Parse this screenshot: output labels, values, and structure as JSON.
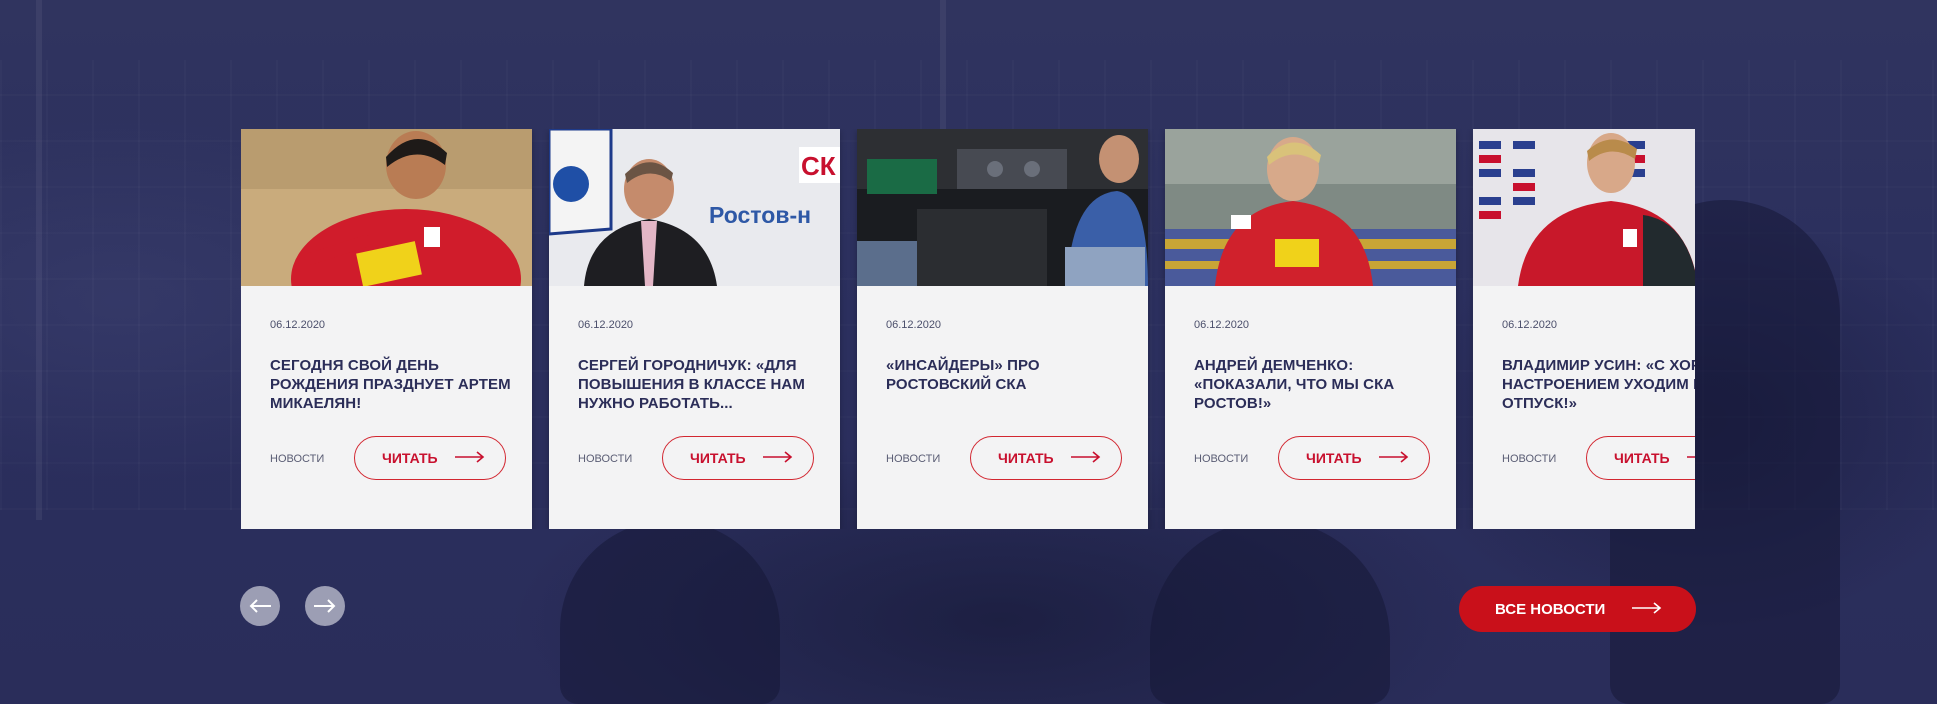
{
  "news": {
    "cards": [
      {
        "date": "06.12.2020",
        "title": "СЕГОДНЯ СВОЙ ДЕНЬ РОЖДЕНИЯ ПРАЗДНУЕТ АРТЕМ МИКАЕЛЯН!",
        "category": "НОВОСТИ",
        "read_label": "ЧИТАТЬ"
      },
      {
        "date": "06.12.2020",
        "title": "СЕРГЕЙ ГОРОДНИЧУК: «ДЛЯ ПОВЫШЕНИЯ  В КЛАССЕ НАМ НУЖНО РАБОТАТЬ...",
        "category": "НОВОСТИ",
        "read_label": "ЧИТАТЬ",
        "image_text": "Ростов-н"
      },
      {
        "date": "06.12.2020",
        "title": "«ИНСАЙДЕРЫ» ПРО РОСТОВСКИЙ СКА",
        "category": "НОВОСТИ",
        "read_label": "ЧИТАТЬ"
      },
      {
        "date": "06.12.2020",
        "title": "АНДРЕЙ ДЕМЧЕНКО: «ПОКАЗАЛИ, ЧТО МЫ СКА РОСТОВ!»",
        "category": "НОВОСТИ",
        "read_label": "ЧИТАТЬ"
      },
      {
        "date": "06.12.2020",
        "title": "ВЛАДИМИР УСИН: «С ХОРОШИМ НАСТРОЕНИЕМ УХОДИМ В ОТПУСК!»",
        "category": "НОВОСТИ",
        "read_label": "ЧИТАТЬ"
      }
    ]
  },
  "controls": {
    "prev_icon": "arrow-left-icon",
    "next_icon": "arrow-right-icon",
    "all_news_label": "ВСЕ НОВОСТИ"
  },
  "colors": {
    "background": "#2a2e5e",
    "card": "#f3f3f4",
    "accent_red": "#c9101a",
    "title_navy": "#2b2d58"
  }
}
